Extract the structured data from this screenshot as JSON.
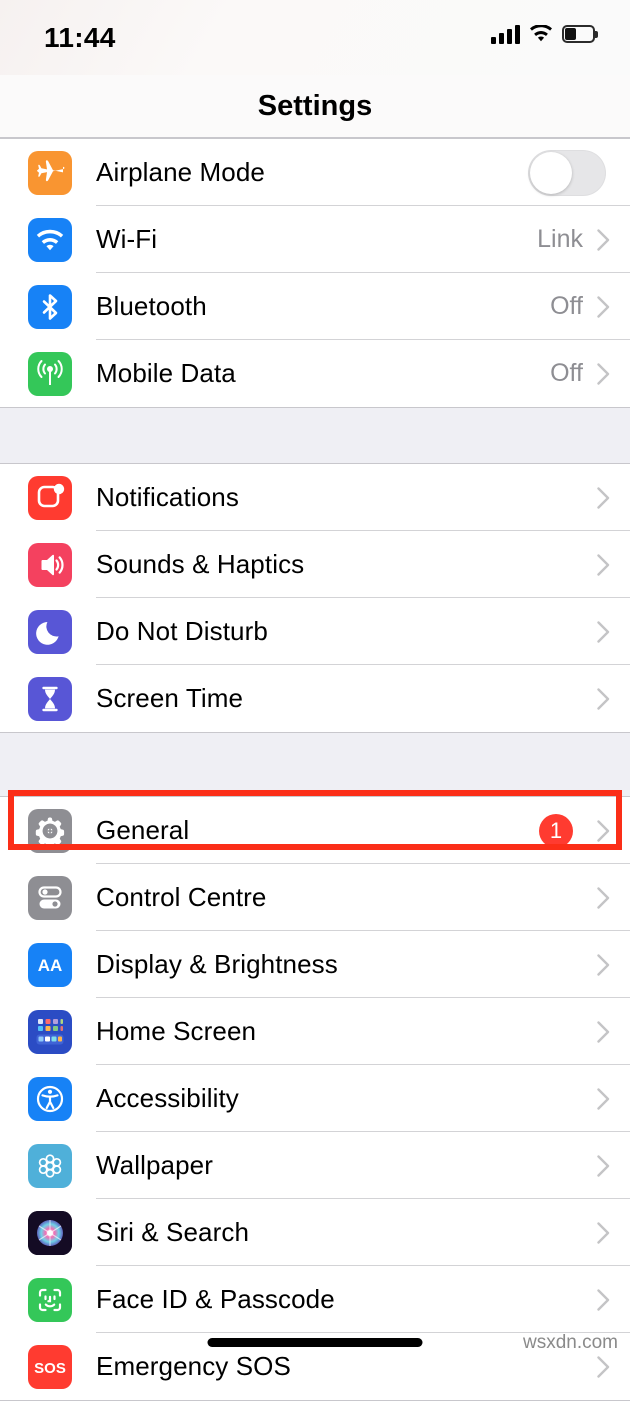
{
  "status_bar": {
    "time": "11:44",
    "signal_icon": "cellular-signal-icon",
    "wifi_icon": "wifi-icon",
    "battery_icon": "battery-icon"
  },
  "navbar": {
    "title": "Settings"
  },
  "groups": [
    {
      "rows": [
        {
          "label": "Airplane Mode",
          "icon": "airplane-icon",
          "color": "#F99531",
          "accessory": "toggle",
          "toggle_on": false
        },
        {
          "label": "Wi-Fi",
          "icon": "wifi-icon",
          "color": "#1782F6",
          "accessory": "chevron",
          "value": "Link"
        },
        {
          "label": "Bluetooth",
          "icon": "bluetooth-icon",
          "color": "#1782F6",
          "accessory": "chevron",
          "value": "Off"
        },
        {
          "label": "Mobile Data",
          "icon": "cellular-antenna-icon",
          "color": "#34C759",
          "accessory": "chevron",
          "value": "Off"
        }
      ]
    },
    {
      "rows": [
        {
          "label": "Notifications",
          "icon": "notifications-icon",
          "color": "#FF3B30",
          "accessory": "chevron",
          "value": ""
        },
        {
          "label": "Sounds & Haptics",
          "icon": "speaker-icon",
          "color": "#F4415F",
          "accessory": "chevron",
          "value": ""
        },
        {
          "label": "Do Not Disturb",
          "icon": "moon-icon",
          "color": "#5856D6",
          "accessory": "chevron",
          "value": ""
        },
        {
          "label": "Screen Time",
          "icon": "hourglass-icon",
          "color": "#5856D6",
          "accessory": "chevron",
          "value": ""
        }
      ]
    },
    {
      "rows": [
        {
          "label": "General",
          "icon": "gear-icon",
          "color": "#8E8E93",
          "accessory": "chevron",
          "badge": "1",
          "highlighted": true
        },
        {
          "label": "Control Centre",
          "icon": "control-centre-icon",
          "color": "#8E8E93",
          "accessory": "chevron",
          "value": ""
        },
        {
          "label": "Display & Brightness",
          "icon": "display-brightness-icon",
          "color": "#1782F6",
          "accessory": "chevron",
          "value": ""
        },
        {
          "label": "Home Screen",
          "icon": "home-screen-icon",
          "color": "#2B4CC4",
          "accessory": "chevron",
          "value": ""
        },
        {
          "label": "Accessibility",
          "icon": "accessibility-icon",
          "color": "#1782F6",
          "accessory": "chevron",
          "value": ""
        },
        {
          "label": "Wallpaper",
          "icon": "wallpaper-icon",
          "color": "#4FB0D9",
          "accessory": "chevron",
          "value": ""
        },
        {
          "label": "Siri & Search",
          "icon": "siri-icon",
          "color": "#1B1030",
          "accessory": "chevron",
          "value": ""
        },
        {
          "label": "Face ID & Passcode",
          "icon": "face-id-icon",
          "color": "#34C759",
          "accessory": "chevron",
          "value": ""
        },
        {
          "label": "Emergency SOS",
          "icon": "sos-icon",
          "color": "#FF3B30",
          "accessory": "chevron",
          "value": ""
        }
      ]
    }
  ],
  "annotation": {
    "highlight_color": "#FB2E18",
    "target": "General"
  },
  "watermark": {
    "text": "wsxdn.com"
  }
}
